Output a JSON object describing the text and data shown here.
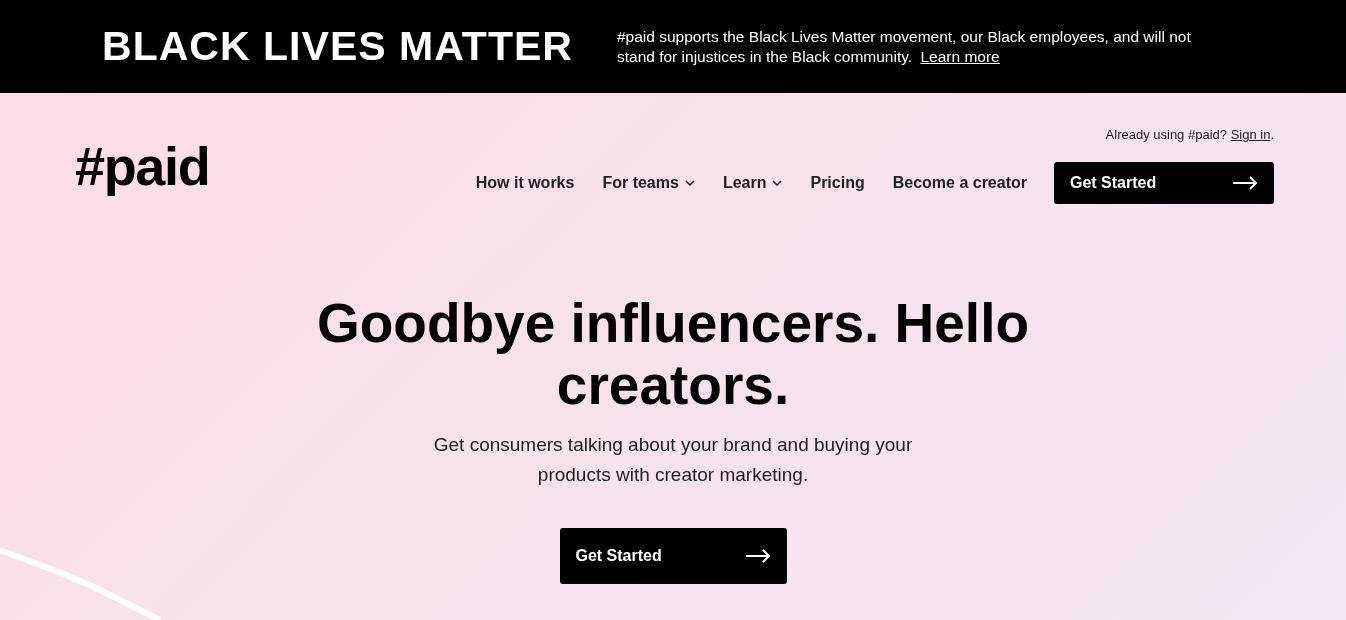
{
  "banner": {
    "title": "BLACK LIVES MATTER",
    "message": "#paid supports the Black Lives Matter movement, our Black employees, and will not stand for injustices in the Black community.",
    "link": "Learn more"
  },
  "header": {
    "logo": "#paid",
    "signin_prompt": "Already using #paid?",
    "signin_link": "Sign in",
    "signin_end": ".",
    "nav": [
      {
        "label": "How it works",
        "kind": "link"
      },
      {
        "label": "For teams",
        "kind": "dropdown"
      },
      {
        "label": "Learn",
        "kind": "dropdown"
      },
      {
        "label": "Pricing",
        "kind": "link"
      },
      {
        "label": "Become a creator",
        "kind": "link"
      }
    ],
    "cta": "Get Started"
  },
  "hero": {
    "headline": "Goodbye influencers. Hello creators.",
    "subtitle": "Get consumers talking about your brand and buying your products with creator marketing.",
    "cta": "Get Started"
  }
}
